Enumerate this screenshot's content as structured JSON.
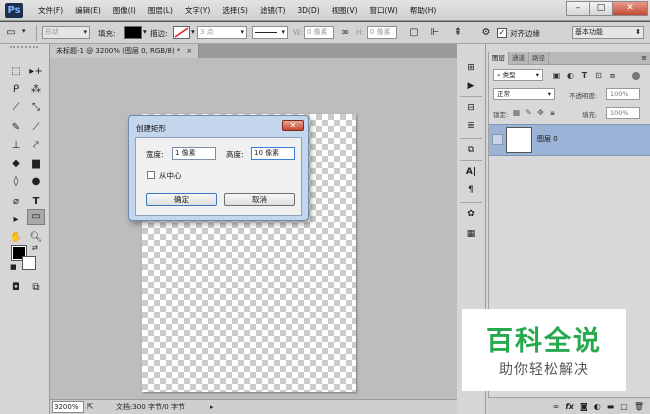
{
  "app": {
    "logo": "Ps"
  },
  "menu": [
    "文件(F)",
    "编辑(E)",
    "图像(I)",
    "图层(L)",
    "文字(Y)",
    "选择(S)",
    "滤镜(T)",
    "3D(D)",
    "视图(V)",
    "窗口(W)",
    "帮助(H)"
  ],
  "window_controls": {
    "minimize": "–",
    "maximize": "□",
    "close": "✕"
  },
  "options": {
    "mode": "形状",
    "fill_label": "填充:",
    "stroke_label": "描边:",
    "stroke_width": "3 点",
    "w_label": "W:",
    "w_value": "0 像素",
    "h_label": "H:",
    "h_value": "0 像素",
    "align_edges_label": "对齐边缘",
    "align_edges_checked": true,
    "workspace": "基本功能",
    "fill_color": "#000000"
  },
  "document": {
    "tab_title": "未标题-1 @ 3200% (图层 0, RGB/8) *",
    "close": "×"
  },
  "status": {
    "zoom": "3200%",
    "doc_info": "文档:300 字节/0 字节"
  },
  "dialog": {
    "title": "创建矩形",
    "close": "✕",
    "width_label": "宽度:",
    "width_value": "1 像素",
    "height_label": "高度:",
    "height_value": "10 像素",
    "from_center_label": "从中心",
    "from_center_checked": false,
    "ok_label": "确定",
    "cancel_label": "取消"
  },
  "layers_panel": {
    "tabs": [
      "图层",
      "通道",
      "路径"
    ],
    "kind_filter": "类型",
    "blend_mode": "正常",
    "opacity_label": "不透明度:",
    "opacity_value": "100%",
    "lock_label": "锁定:",
    "fill_label": "填充:",
    "fill_value": "100%",
    "layer_name": "图层 0"
  },
  "watermark": {
    "main": "百科全说",
    "sub": "助你轻松解决"
  }
}
